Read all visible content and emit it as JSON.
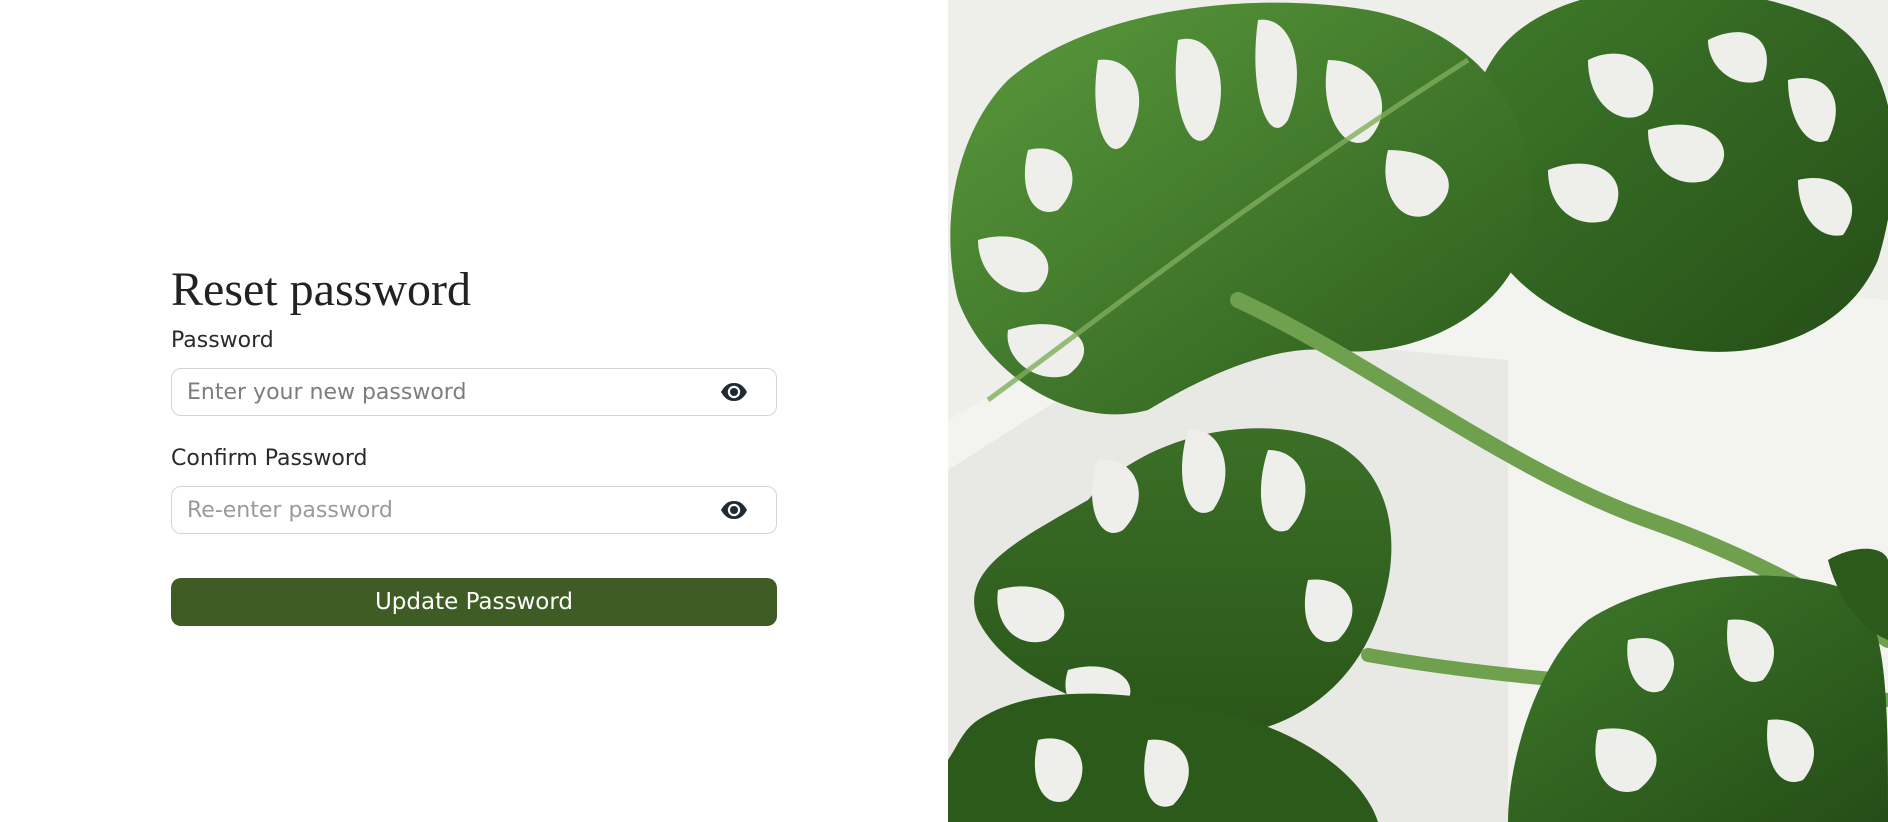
{
  "form": {
    "title": "Reset password",
    "password": {
      "label": "Password",
      "placeholder": "Enter your new password",
      "value": ""
    },
    "confirm": {
      "label": "Confirm Password",
      "placeholder": "Re-enter password",
      "value": ""
    },
    "submit_label": "Update Password"
  },
  "icons": {
    "password_toggle": "eye-icon",
    "confirm_toggle": "eye-icon"
  },
  "colors": {
    "primary_button": "#3f5c24",
    "button_text": "#ffffff",
    "input_border": "#d4d4d4",
    "title_text": "#222222",
    "leaf_dark": "#2f5e1f",
    "leaf_light": "#5a9a3c",
    "image_background": "#eeeeeb"
  }
}
